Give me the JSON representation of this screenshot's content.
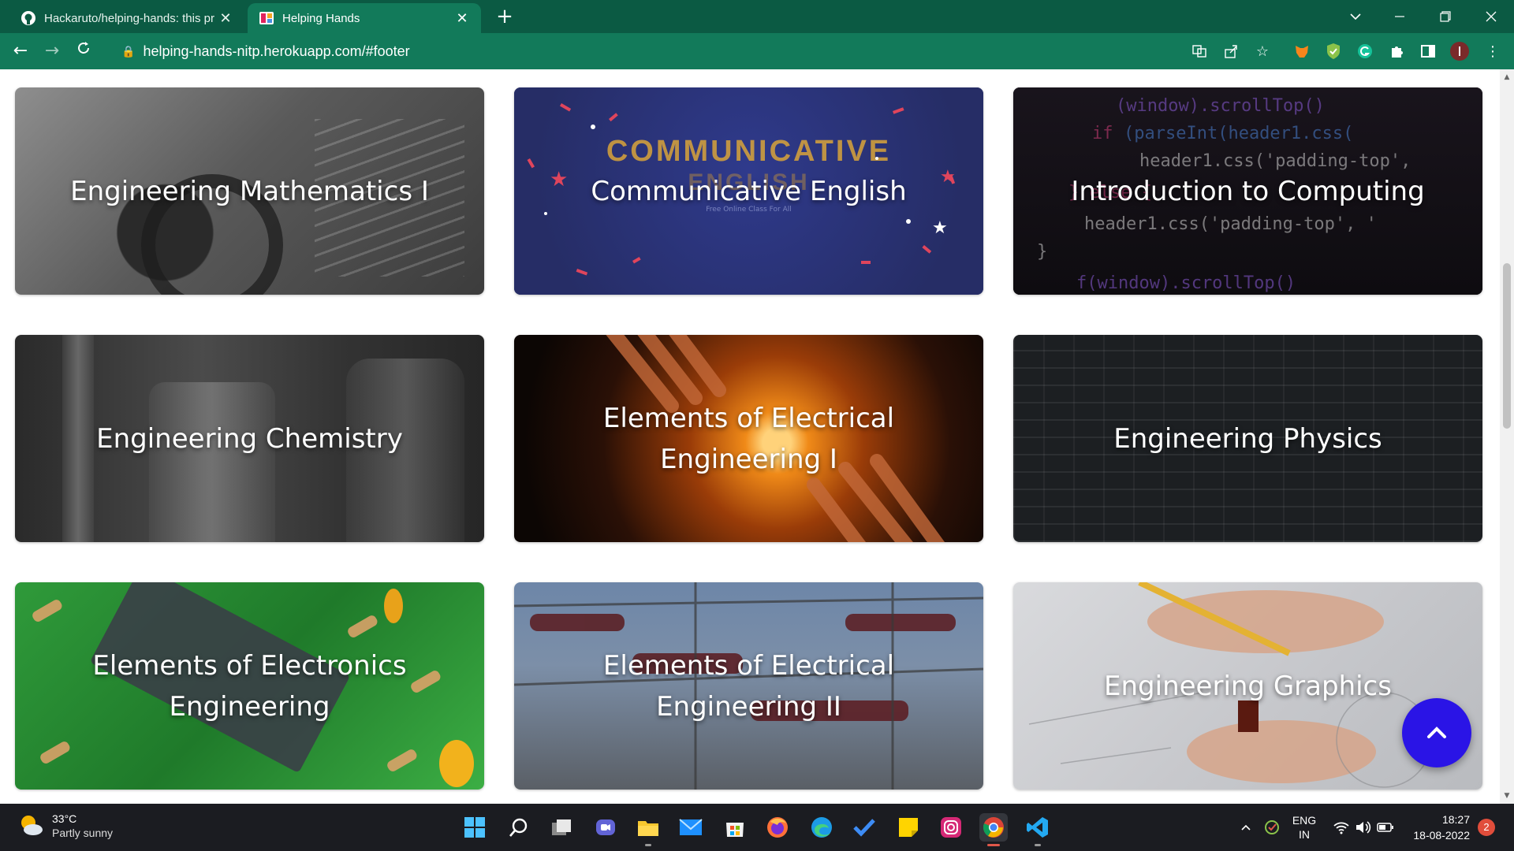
{
  "browser": {
    "tabs": [
      {
        "title": "Hackaruto/helping-hands: this pr",
        "active": false
      },
      {
        "title": "Helping Hands",
        "active": true
      }
    ],
    "new_tab": "+",
    "url": "helping-hands-nitp.herokuapp.com/#footer",
    "theme_color": "#127a5a"
  },
  "courses": [
    {
      "label": "Engineering Mathematics I",
      "theme": "math"
    },
    {
      "label": "Communicative English",
      "theme": "english",
      "banner_text": "COMMUNICATIVE",
      "banner_sub": "ENGLISH",
      "banner_small": "Free Online Class For All"
    },
    {
      "label": "Introduction to Computing",
      "theme": "computing"
    },
    {
      "label": "Engineering Chemistry",
      "theme": "chemistry"
    },
    {
      "label": "Elements of Electrical Engineering I",
      "theme": "electrical1"
    },
    {
      "label": "Engineering Physics",
      "theme": "physics"
    },
    {
      "label": "Elements of Electronics Engineering",
      "theme": "electronics"
    },
    {
      "label": "Elements of Electrical Engineering II",
      "theme": "electrical2"
    },
    {
      "label": "Engineering Graphics",
      "theme": "graphics"
    }
  ],
  "back_to_top": {
    "icon": "chevron-up-icon",
    "color": "#2a14e6"
  },
  "taskbar": {
    "weather_temp": "33°C",
    "weather_desc": "Partly sunny",
    "lang_top": "ENG",
    "lang_bottom": "IN",
    "time": "18:27",
    "date": "18-08-2022",
    "notifications": "2"
  }
}
